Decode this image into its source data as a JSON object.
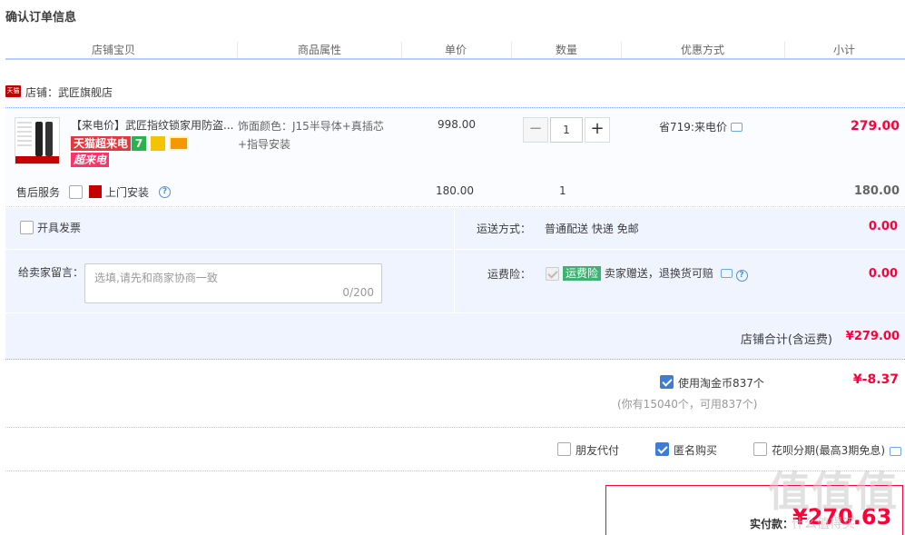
{
  "page_title": "确认订单信息",
  "columns": [
    "店铺宝贝",
    "商品属性",
    "单价",
    "数量",
    "优惠方式",
    "小计"
  ],
  "shop": {
    "badge": "天猫",
    "label": "店铺：武匠旗舰店"
  },
  "item": {
    "title": "【来电价】武匠指纹锁家用防盗...",
    "tag_primary": "天猫超来电",
    "tag_secondary": "超来电",
    "tag_seven": "7",
    "attributes": "饰面颜色：J15半导体+真插芯+指导安装",
    "unit_price": "998.00",
    "quantity": "1",
    "qty_minus": "−",
    "qty_plus": "+",
    "promo": "省719:来电价",
    "subtotal": "279.00"
  },
  "service": {
    "label": "售后服务",
    "option": "上门安装",
    "price": "180.00",
    "quantity": "1",
    "subtotal": "180.00"
  },
  "invoice": {
    "label": "开具发票"
  },
  "shipping": {
    "label": "运送方式：",
    "value": "普通配送 快递 免邮",
    "amount": "0.00"
  },
  "message": {
    "label": "给卖家留言：",
    "placeholder": "选填,请先和商家协商一致",
    "counter": "0/200"
  },
  "insurance": {
    "label": "运费险：",
    "tag": "运费险",
    "desc": "卖家赠送，退换货可赔",
    "amount": "0.00"
  },
  "shop_total": {
    "label": "店铺合计(含运费)",
    "amount": "¥279.00"
  },
  "coins": {
    "label": "使用淘金币837个",
    "sub": "(你有15040个，可用837个)",
    "amount": "¥-8.37"
  },
  "options": [
    {
      "label": "朋友代付",
      "checked": false
    },
    {
      "label": "匿名购买",
      "checked": true
    },
    {
      "label": "花呗分期(最高3期免息)",
      "checked": false
    }
  ],
  "pay": {
    "label": "实付款：",
    "amount": "¥270.63"
  },
  "watermark": {
    "text": "值值值",
    "sub": "什么值得买"
  },
  "colors": {
    "accent_red": "#ff0036",
    "light_blue": "#eff4ff",
    "border_blue": "#b2d1ff",
    "check_blue": "#3d7dd8"
  }
}
